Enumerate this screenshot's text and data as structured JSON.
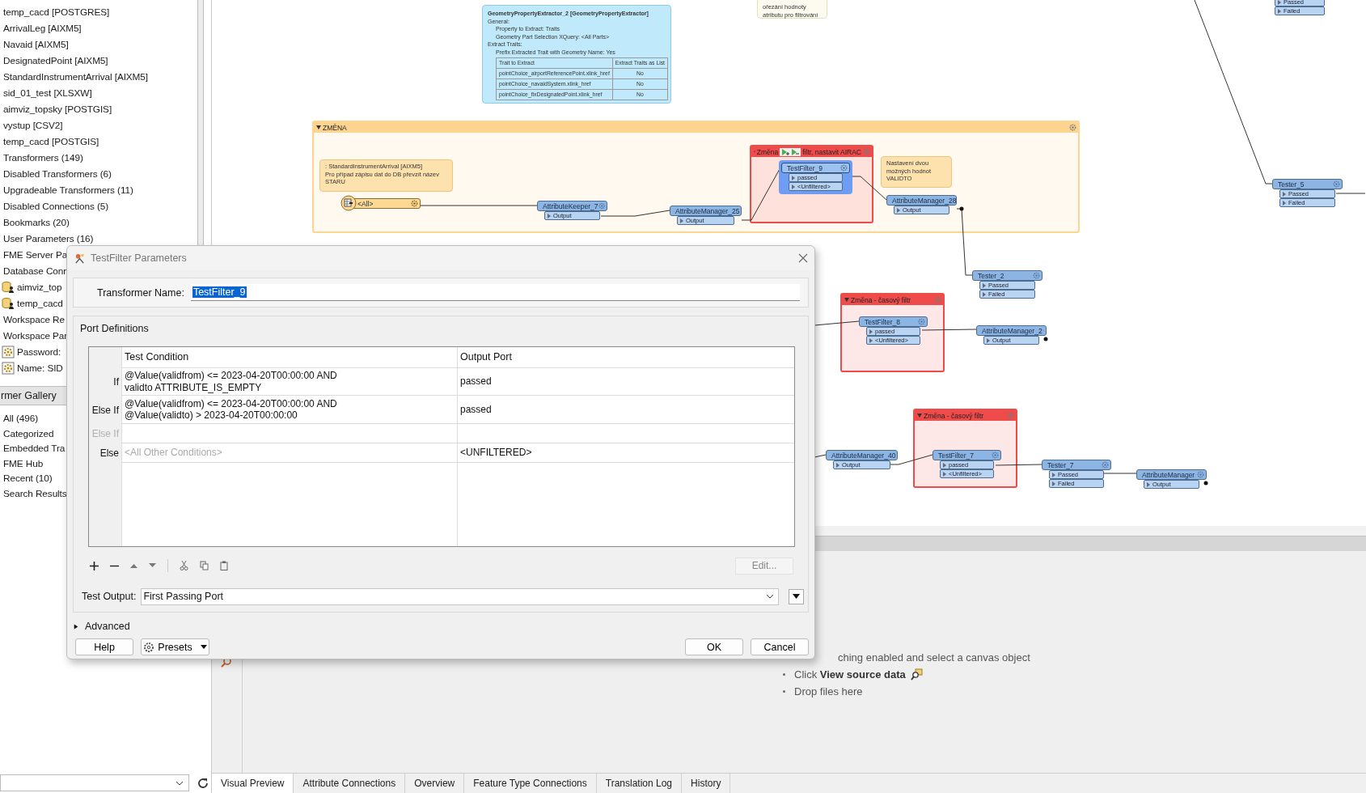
{
  "navigator": {
    "items": [
      {
        "kind": "plain",
        "label": "temp_cacd [POSTGRES]"
      },
      {
        "kind": "plain",
        "label": "ArrivalLeg [AIXM5]"
      },
      {
        "kind": "plain",
        "label": "Navaid [AIXM5]"
      },
      {
        "kind": "plain",
        "label": "DesignatedPoint [AIXM5]"
      },
      {
        "kind": "plain",
        "label": "StandardInstrumentArrival [AIXM5]"
      },
      {
        "kind": "plain",
        "label": "sid_01_test [XLSXW]"
      },
      {
        "kind": "plain",
        "label": "aimviz_topsky [POSTGIS]"
      },
      {
        "kind": "plain",
        "label": "vystup [CSV2]"
      },
      {
        "kind": "plain",
        "label": "temp_cacd [POSTGIS]"
      },
      {
        "kind": "plain",
        "label": "Transformers (149)"
      },
      {
        "kind": "plain",
        "label": "Disabled Transformers (6)"
      },
      {
        "kind": "plain",
        "label": "Upgradeable Transformers (11)"
      },
      {
        "kind": "plain",
        "label": "Disabled Connections (5)"
      },
      {
        "kind": "plain",
        "label": "Bookmarks (20)"
      },
      {
        "kind": "plain",
        "label": "User Parameters (16)"
      },
      {
        "kind": "plain",
        "label": "FME Server Pa"
      },
      {
        "kind": "plain",
        "label": "Database Conn"
      },
      {
        "kind": "database",
        "label": "aimviz_top"
      },
      {
        "kind": "database",
        "label": "temp_cacd"
      },
      {
        "kind": "plain",
        "label": "Workspace Re"
      },
      {
        "kind": "plain",
        "label": "Workspace Par"
      },
      {
        "kind": "parameter",
        "label": "Password:"
      },
      {
        "kind": "parameter",
        "label": "Name: SID"
      }
    ]
  },
  "gallery": {
    "title": "rmer Gallery",
    "items": [
      "All (496)",
      "Categorized",
      "Embedded Tra",
      "FME Hub",
      "Recent (10)",
      "Search Results"
    ]
  },
  "canvas": {
    "bookmarks": [
      {
        "title": "ZMĚNA",
        "color": "#fdd591"
      },
      {
        "title": "Změna",
        "title_after": "filtr, nastavit AIRAC",
        "color": "#f04b4b"
      },
      {
        "title": "Změna - časový filtr",
        "color": "#f04b4b"
      },
      {
        "title": "Změna - časový filtr",
        "color": "#f04b4b"
      }
    ],
    "annotations": [
      {
        "kind": "summary",
        "title": "GeometryPropertyExtractor_2 [GeometryPropertyExtractor]",
        "sections": [
          {
            "heading": "General:",
            "children": [
              "Property to Extract: Traits",
              "Geometry Part Selection XQuery: <All Parts>"
            ]
          },
          {
            "heading": "Extract Traits:",
            "children": [
              "Prefix Extracted Trait with Geometry Name: Yes"
            ]
          }
        ],
        "table": {
          "columns": [
            "Trait to Extract",
            "Extract Traits as List"
          ],
          "rows": [
            [
              "pointChoice_airportReferencePoint.xlink_href",
              "No"
            ],
            [
              "pointChoice_navaidSystem.xlink_href",
              "No"
            ],
            [
              "pointChoice_fixDesignatedPoint.xlink_href",
              "No"
            ]
          ]
        }
      },
      {
        "kind": "note",
        "text": "ořezání hodnoty\natributu pro filtrování"
      },
      {
        "kind": "note",
        "text": ": StandardInstrumentArrival [AIXM5]\nPro případ zápisu dat do DB převzít název\nSTARU"
      },
      {
        "kind": "note",
        "text": "Nastavení dvou\nmožných hodnot\nVALIDTO"
      }
    ],
    "transformers": [
      {
        "kind": "reader",
        "name": "<All>",
        "selected": false
      },
      {
        "kind": "transformer",
        "name": "AttributeKeeper_7",
        "selected": false,
        "ports": [
          "Output"
        ]
      },
      {
        "kind": "transformer",
        "name": "AttributeManager_25",
        "selected": false,
        "ports": [
          "Output"
        ]
      },
      {
        "kind": "transformer",
        "name": "TestFilter_9",
        "selected": true,
        "ports": [
          "passed",
          "<Unfiltered>"
        ]
      },
      {
        "kind": "transformer",
        "name": "AttributeManager_28",
        "selected": false,
        "ports": [
          "Output"
        ]
      },
      {
        "kind": "transformer",
        "name": "Tester_2",
        "selected": false,
        "ports": [
          "Passed",
          "Failed"
        ]
      },
      {
        "kind": "transformer",
        "name": "TestFilter_8",
        "selected": false,
        "ports": [
          "passed",
          "<Unfiltered>"
        ]
      },
      {
        "kind": "transformer",
        "name": "AttributeManager_2",
        "selected": false,
        "ports": [
          "Output"
        ]
      },
      {
        "kind": "transformer",
        "name": "AttributeManager_40",
        "selected": false,
        "ports": [
          "Output"
        ]
      },
      {
        "kind": "transformer",
        "name": "TestFilter_7",
        "selected": false,
        "ports": [
          "passed",
          "<Unfiltered>"
        ]
      },
      {
        "kind": "transformer",
        "name": "Tester_7",
        "selected": false,
        "ports": [
          "Passed",
          "Failed"
        ]
      },
      {
        "kind": "transformer",
        "name": "AttributeManager",
        "selected": false,
        "ports": [
          "Output"
        ]
      },
      {
        "kind": "ports-only",
        "ports": [
          "Passed",
          "Failed"
        ]
      },
      {
        "kind": "transformer",
        "name": "Tester_5",
        "selected": false,
        "ports": [
          "Passed",
          "Failed"
        ]
      }
    ]
  },
  "preview": {
    "message": "ching enabled and select a canvas object",
    "bullets": [
      {
        "text": "Click **View source data**",
        "icon": true
      },
      {
        "text": "Drop files here",
        "icon": false
      }
    ]
  },
  "bottom_tabs": [
    {
      "label": "Visual Preview",
      "selected": true
    },
    {
      "label": "Attribute Connections",
      "selected": false
    },
    {
      "label": "Overview",
      "selected": false
    },
    {
      "label": "Feature Type Connections",
      "selected": false
    },
    {
      "label": "Translation Log",
      "selected": false
    },
    {
      "label": "History",
      "selected": false
    }
  ],
  "dialog": {
    "title": "TestFilter Parameters",
    "transformer_name": {
      "label": "Transformer Name:",
      "value": "TestFilter_9",
      "value_selected": true
    },
    "port_definitions": {
      "title": "Port Definitions",
      "columns": [
        "Test Condition",
        "Output Port"
      ],
      "rows": [
        {
          "label": "If",
          "enabled": true,
          "condition": "@Value(validfrom) <= 2023-04-20T00:00:00 AND\nvalidto ATTRIBUTE_IS_EMPTY",
          "port": "passed"
        },
        {
          "label": "Else If",
          "enabled": true,
          "condition": "@Value(validfrom) <= 2023-04-20T00:00:00 AND\n@Value(validto) > 2023-04-20T00:00:00",
          "port": "passed"
        },
        {
          "label": "Else If",
          "enabled": false
        },
        {
          "label": "Else",
          "enabled": true,
          "placeholder": "<All Other Conditions>",
          "port": "<UNFILTERED>"
        }
      ]
    },
    "edit_button": {
      "label": "Edit...",
      "disabled": true
    },
    "test_output": {
      "label": "Test Output:",
      "value": "First Passing Port"
    },
    "advanced": {
      "label": "Advanced",
      "expanded": false
    },
    "buttons": [
      {
        "kind": "help",
        "label": "Help"
      },
      {
        "kind": "presets",
        "label": "Presets"
      },
      {
        "kind": "ok",
        "label": "OK"
      },
      {
        "kind": "cancel",
        "label": "Cancel"
      }
    ]
  }
}
